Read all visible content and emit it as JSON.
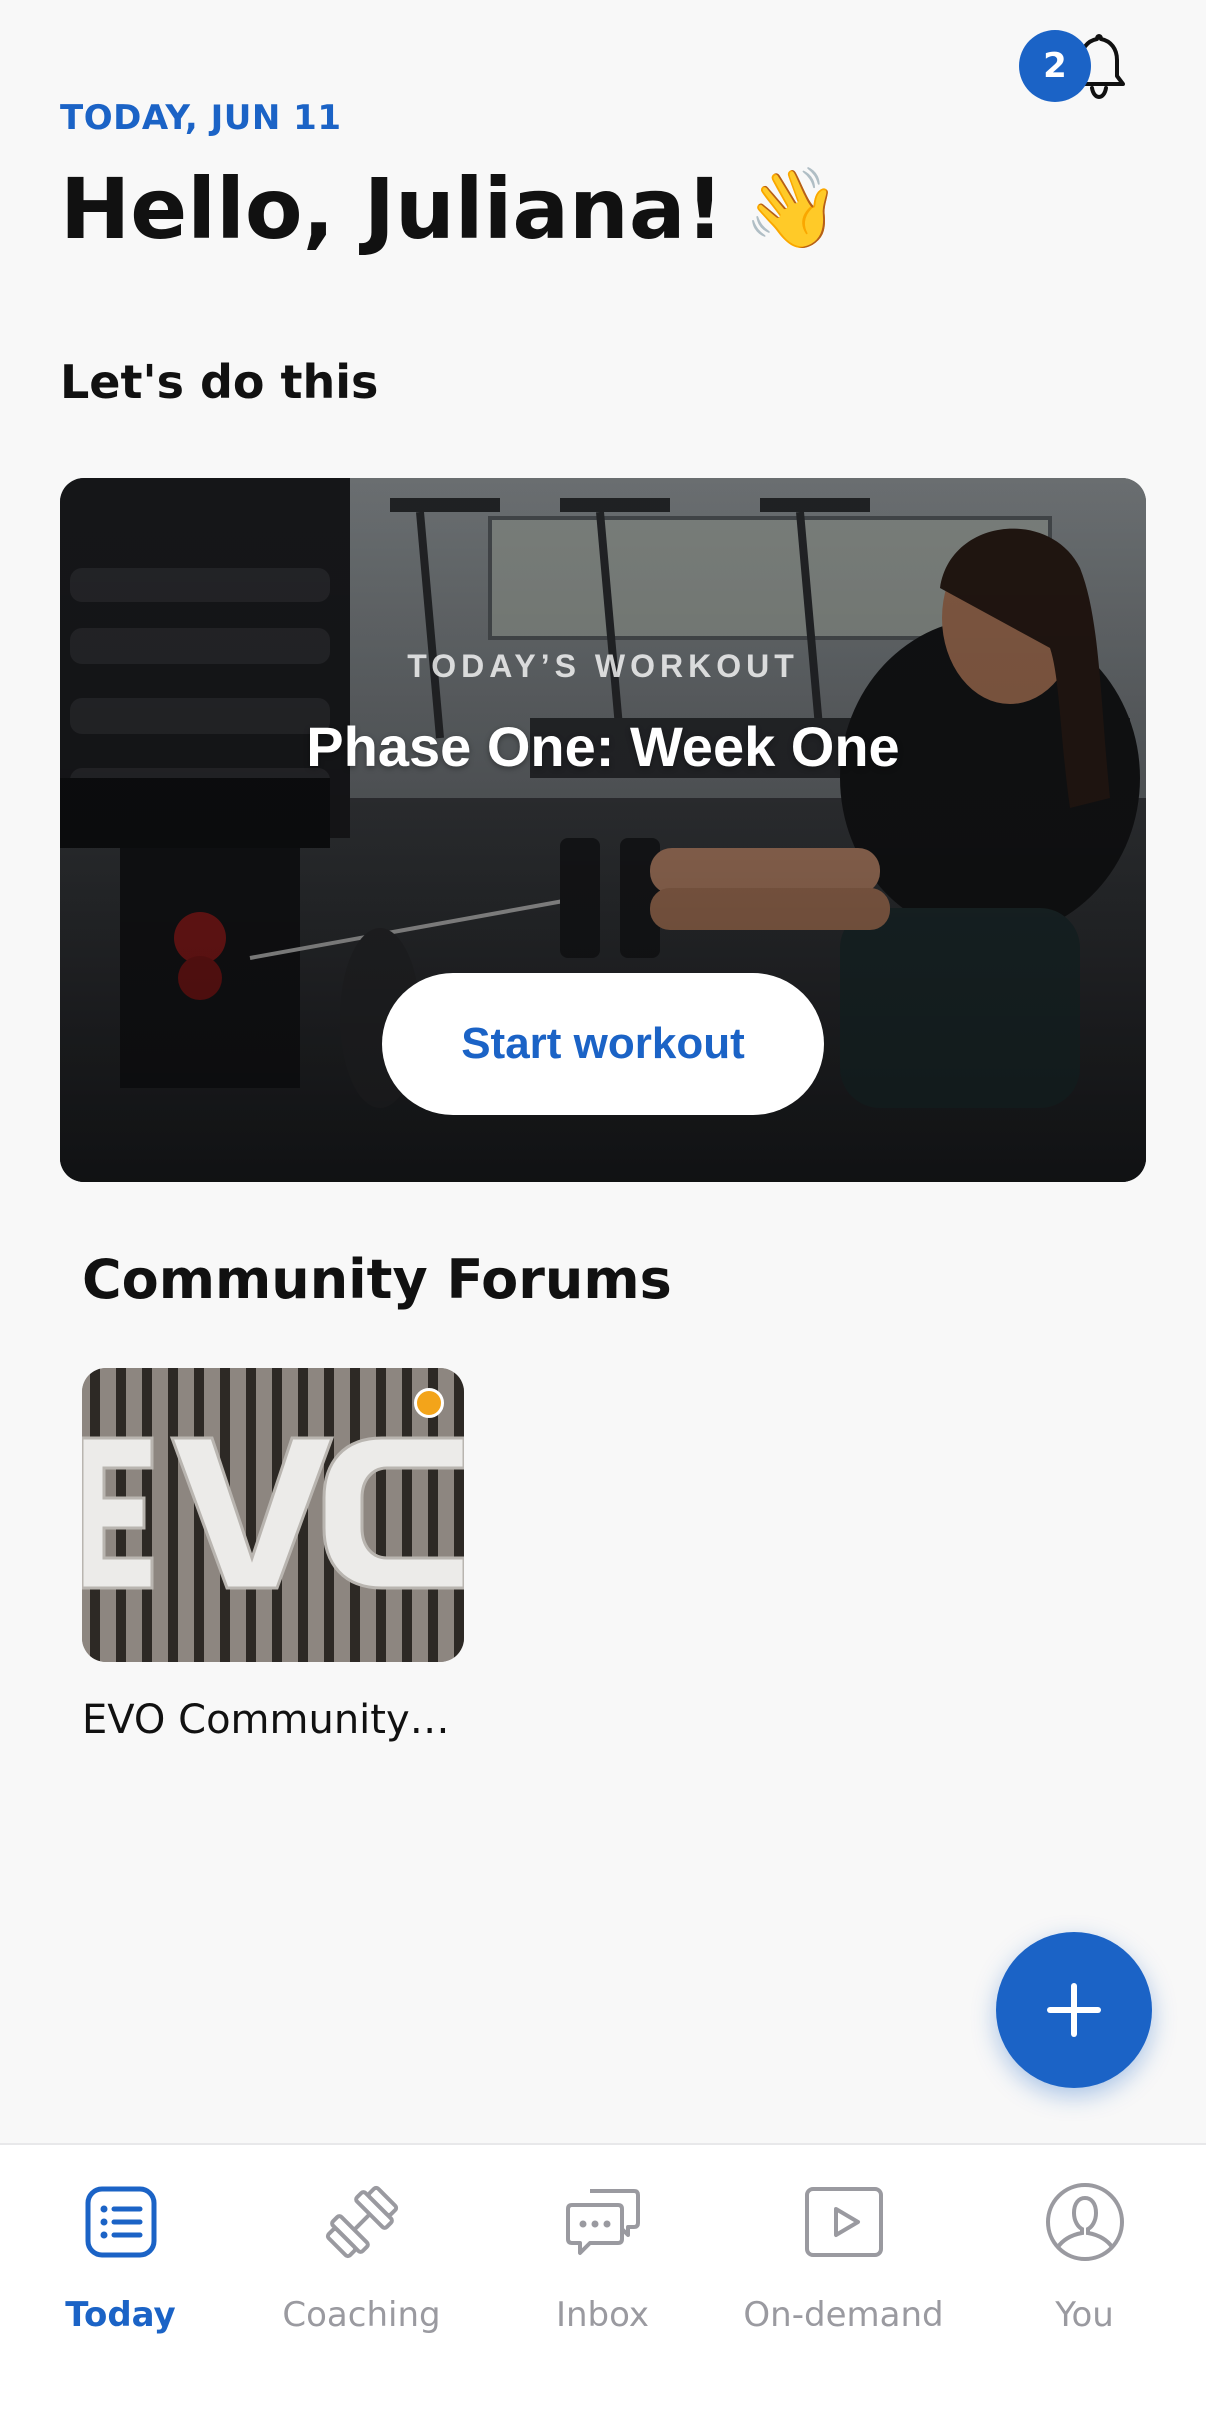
{
  "header": {
    "date": "TODAY, JUN 11",
    "greeting": "Hello, Juliana!",
    "greeting_emoji": "👋",
    "notification_count": "2"
  },
  "sections": {
    "lets_do_title": "Let's do this",
    "community_title": "Community Forums"
  },
  "workout": {
    "kicker": "TODAY’S WORKOUT",
    "title": "Phase One: Week One",
    "start_label": "Start workout"
  },
  "forum": {
    "label": "EVO Community…",
    "has_unread": true
  },
  "tabs": [
    {
      "label": "Today",
      "icon": "list-icon",
      "active": true
    },
    {
      "label": "Coaching",
      "icon": "dumbbell-icon",
      "active": false
    },
    {
      "label": "Inbox",
      "icon": "chat-bubbles-icon",
      "active": false
    },
    {
      "label": "On-demand",
      "icon": "play-icon",
      "active": false
    },
    {
      "label": "You",
      "icon": "profile-icon",
      "active": false
    }
  ],
  "colors": {
    "accent": "#1b63c6",
    "unread_dot": "#f3a41a",
    "inactive_tab": "#9a9aa0"
  }
}
